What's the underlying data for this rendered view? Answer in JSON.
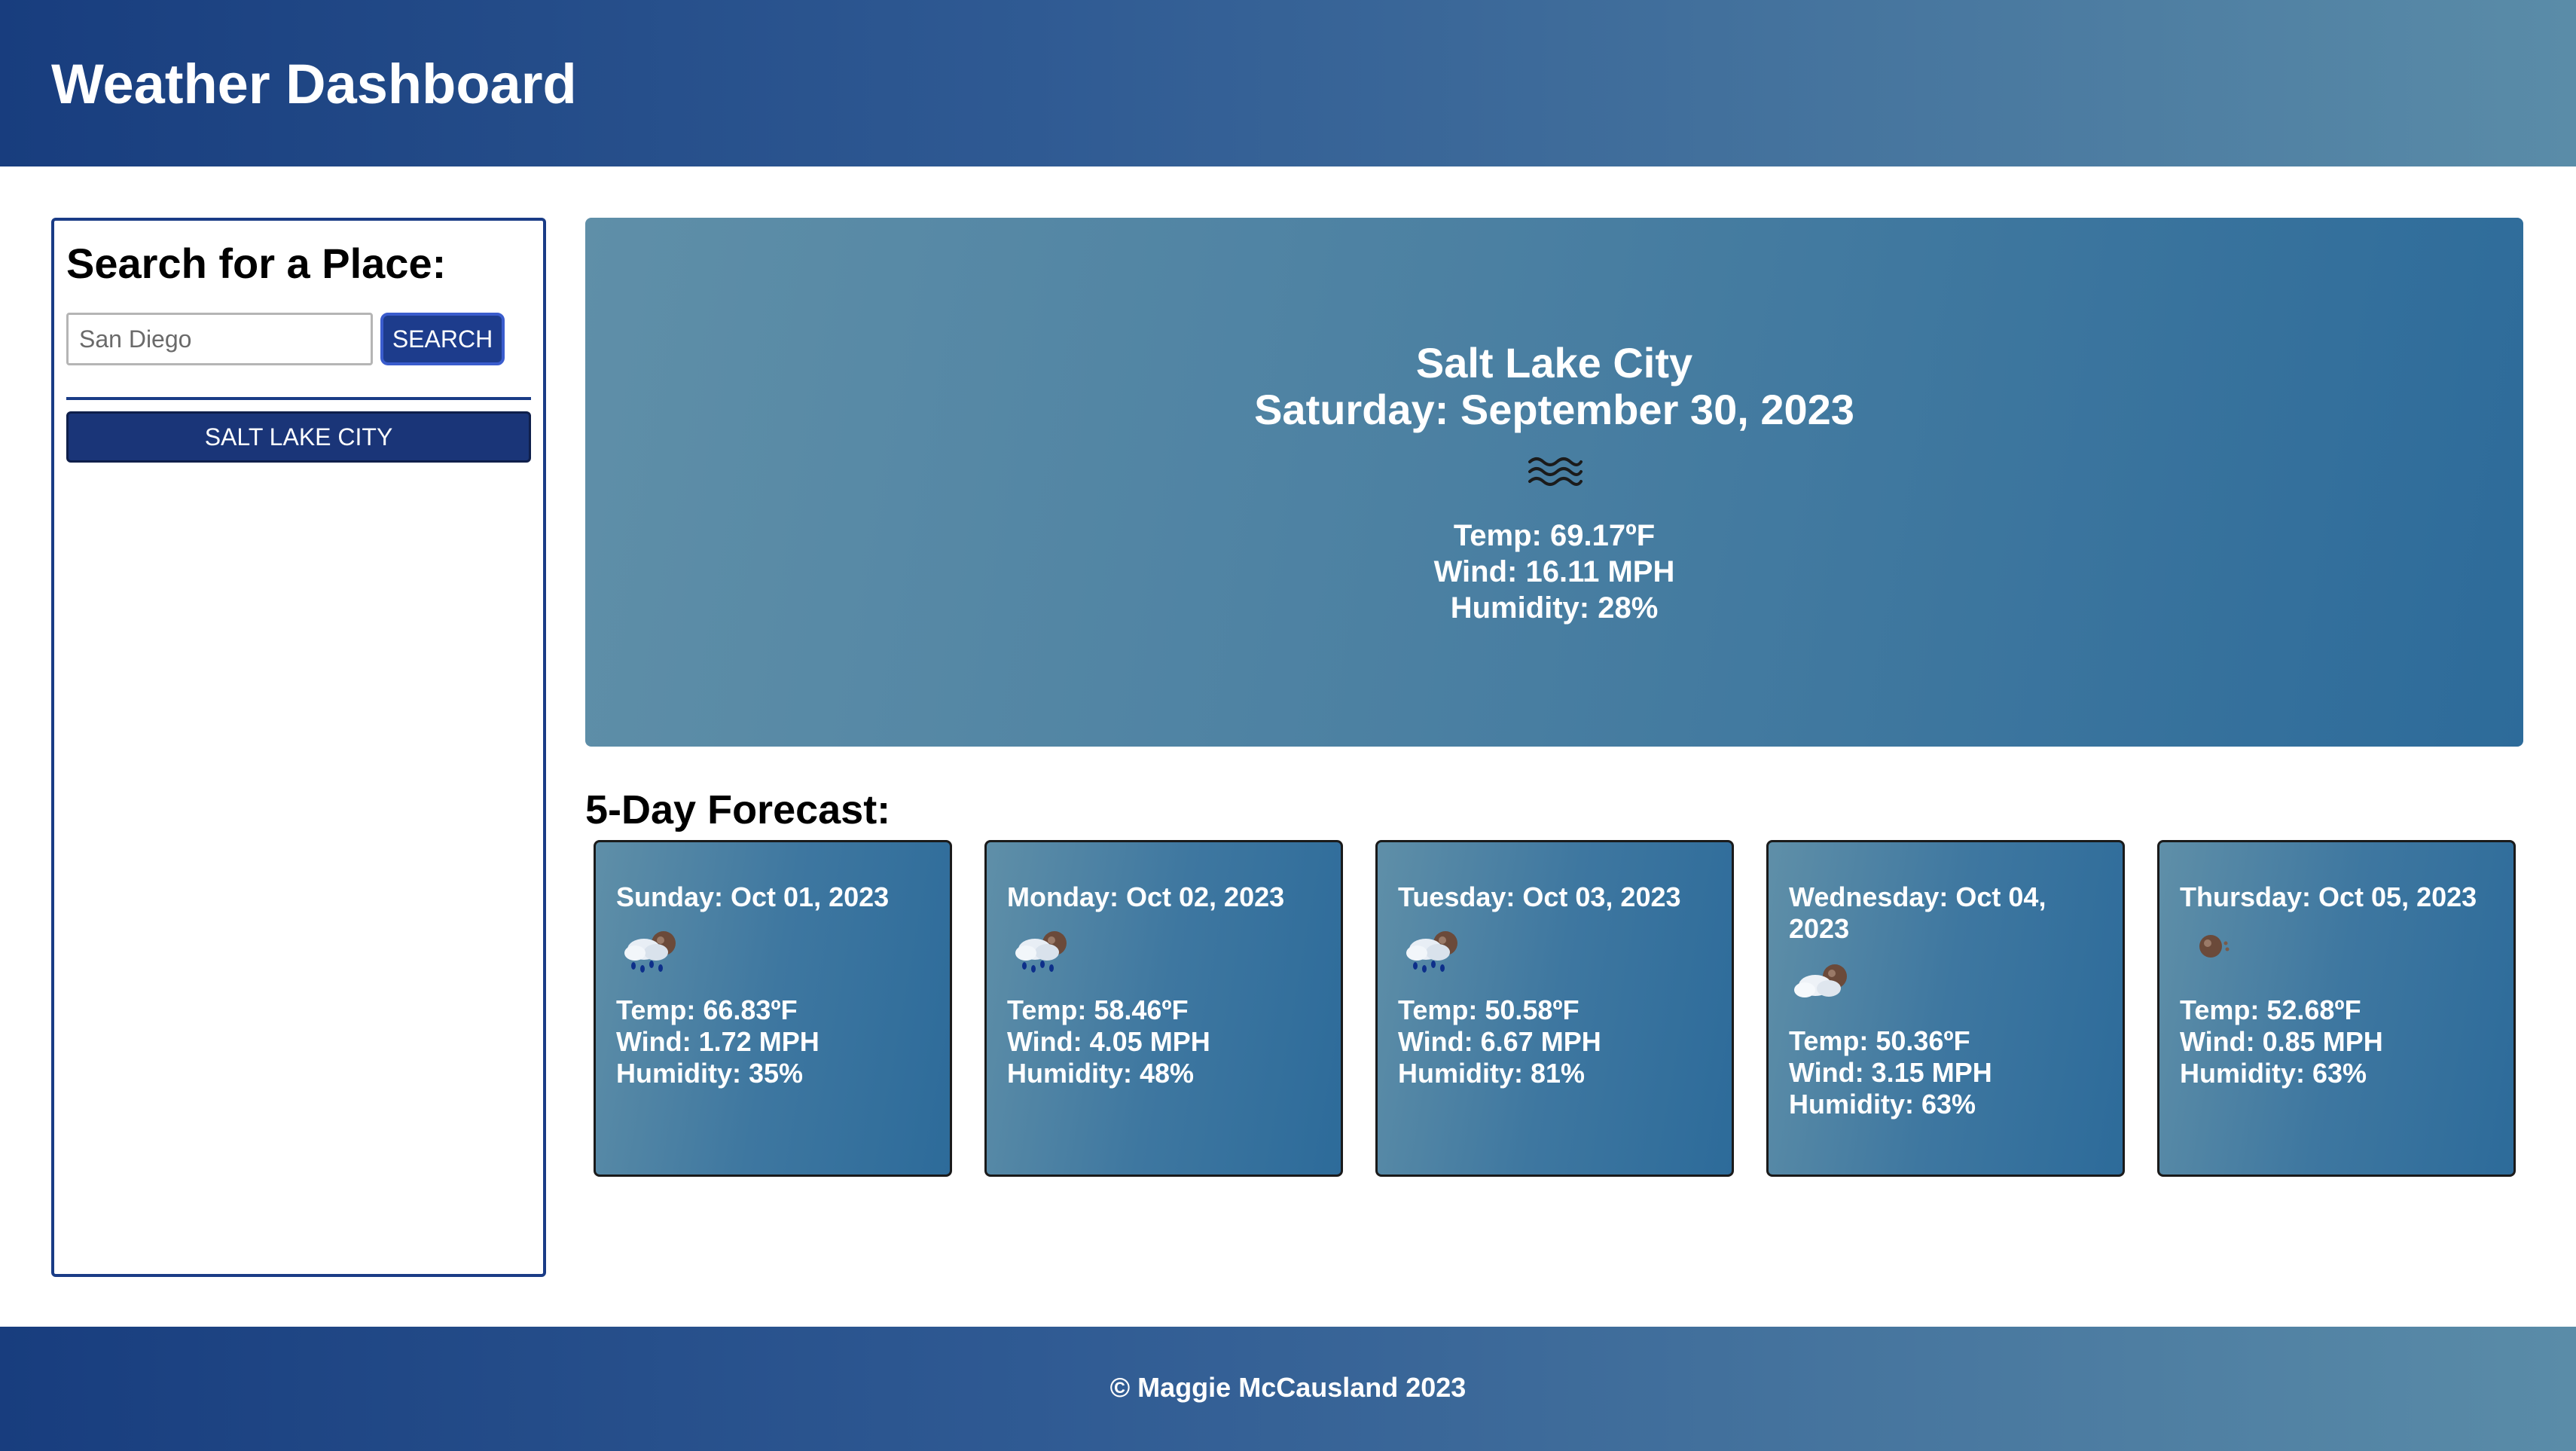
{
  "header": {
    "title": "Weather Dashboard"
  },
  "sidebar": {
    "heading": "Search for a Place:",
    "search_placeholder": "San Diego",
    "search_value": "",
    "search_button_label": "SEARCH",
    "history": [
      "SALT LAKE CITY"
    ]
  },
  "current": {
    "city": "Salt Lake City",
    "date": "Saturday: September 30, 2023",
    "icon": "mist-icon",
    "temp": "Temp: 69.17ºF",
    "wind": "Wind: 16.11 MPH",
    "humidity": "Humidity: 28%"
  },
  "forecast": {
    "title": "5-Day Forecast:",
    "days": [
      {
        "day": "Sunday: Oct 01, 2023",
        "icon": "rain-icon",
        "temp": "Temp: 66.83ºF",
        "wind": "Wind: 1.72 MPH",
        "humidity": "Humidity: 35%"
      },
      {
        "day": "Monday: Oct 02, 2023",
        "icon": "rain-icon",
        "temp": "Temp: 58.46ºF",
        "wind": "Wind: 4.05 MPH",
        "humidity": "Humidity: 48%"
      },
      {
        "day": "Tuesday: Oct 03, 2023",
        "icon": "rain-icon",
        "temp": "Temp: 50.58ºF",
        "wind": "Wind: 6.67 MPH",
        "humidity": "Humidity: 81%"
      },
      {
        "day": "Wednesday: Oct 04, 2023",
        "icon": "broken-clouds-icon",
        "temp": "Temp: 50.36ºF",
        "wind": "Wind: 3.15 MPH",
        "humidity": "Humidity: 63%"
      },
      {
        "day": "Thursday: Oct 05, 2023",
        "icon": "clear-sky-icon",
        "temp": "Temp: 52.68ºF",
        "wind": "Wind: 0.85 MPH",
        "humidity": "Humidity: 63%"
      }
    ]
  },
  "footer": {
    "copyright": "© Maggie McCausland 2023"
  }
}
